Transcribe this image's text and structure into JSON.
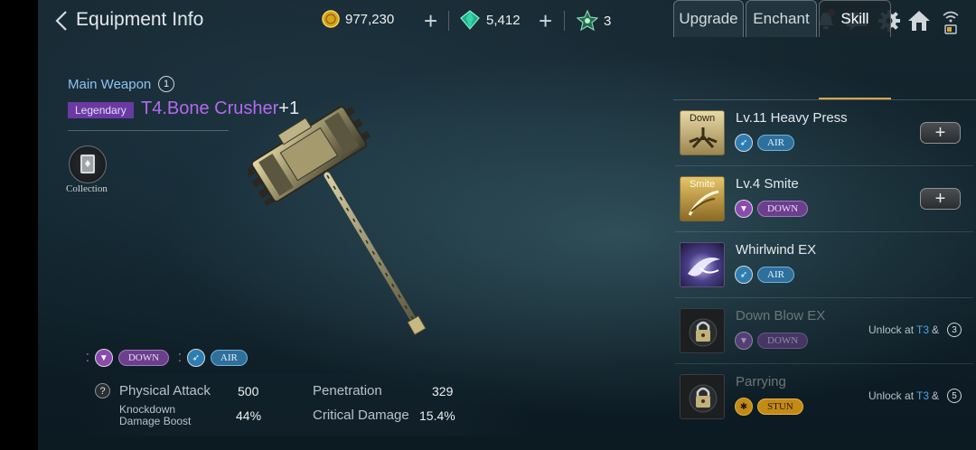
{
  "header": {
    "title": "Equipment Info",
    "gold": "977,230",
    "gems": "5,412",
    "tickets": "3"
  },
  "item": {
    "slot": "Main Weapon",
    "slot_badge": "1",
    "rarity": "Legendary",
    "name": "T4.Bone Crusher",
    "enhance": "+1",
    "collection_label": "Collection"
  },
  "attributes": [
    {
      "type": "down",
      "label": "DOWN"
    },
    {
      "type": "air",
      "label": "AIR"
    }
  ],
  "stats": {
    "help": "?",
    "physical_attack_label": "Physical Attack",
    "physical_attack_value": "500",
    "knockdown_label_1": "Knockdown",
    "knockdown_label_2": "Damage Boost",
    "knockdown_value": "44%",
    "penetration_label": "Penetration",
    "penetration_value": "329",
    "crit_label": "Critical Damage",
    "crit_value": "15.4%"
  },
  "tabs": [
    {
      "label": "Upgrade",
      "active": false
    },
    {
      "label": "Enchant",
      "active": false
    },
    {
      "label": "Skill",
      "active": true
    }
  ],
  "skills": [
    {
      "name": "Lv.11 Heavy Press",
      "tag": "AIR",
      "tag_type": "air",
      "icon_text": "Down",
      "icon": "heavy-press-icon",
      "action": "+",
      "locked": false
    },
    {
      "name": "Lv.4 Smite",
      "tag": "DOWN",
      "tag_type": "down",
      "icon_text": "Smite",
      "icon": "smite-icon",
      "action": "+",
      "locked": false
    },
    {
      "name": "Whirlwind EX",
      "tag": "AIR",
      "tag_type": "air",
      "icon_text": "",
      "icon": "whirlwind-icon",
      "action": "",
      "locked": false
    },
    {
      "name": "Down Blow EX",
      "tag": "DOWN",
      "tag_type": "down",
      "icon_text": "",
      "icon": "lock-icon",
      "locked": true,
      "unlock_prefix": "Unlock at",
      "unlock_tier": "T3",
      "unlock_suffix": "&",
      "unlock_level": "3"
    },
    {
      "name": "Parrying",
      "tag": "STUN",
      "tag_type": "stun",
      "icon_text": "",
      "icon": "lock-icon",
      "locked": true,
      "unlock_prefix": "Unlock at",
      "unlock_tier": "T3",
      "unlock_suffix": "&",
      "unlock_level": "5"
    }
  ],
  "colors": {
    "legendary": "#b469ef",
    "accent_gold": "#d6a64a",
    "tier_blue": "#4aa4ea"
  }
}
